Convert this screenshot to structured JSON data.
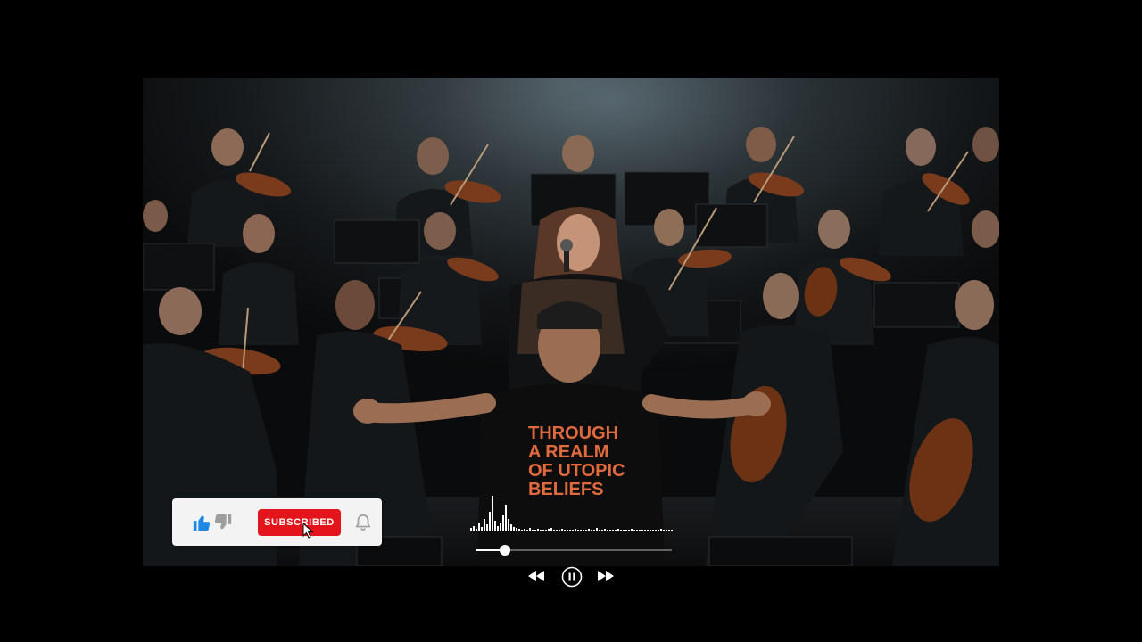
{
  "overlay": {
    "subscribe_label": "SUBSCRIBED",
    "like_icon": "thumbs-up-icon",
    "dislike_icon": "thumbs-down-icon",
    "bell_icon": "notification-bell-icon",
    "cursor_icon": "mouse-pointer-icon"
  },
  "video": {
    "shirt_text": [
      "THROUGH",
      "A REALM",
      "OF UTOPIC",
      "BELIEFS"
    ]
  },
  "player": {
    "progress_fraction": 0.15,
    "rewind_icon": "rewind-icon",
    "pause_icon": "pause-icon",
    "forward_icon": "fast-forward-icon"
  },
  "colors": {
    "subscribe_red": "#e3141c",
    "like_blue": "#1e88e5",
    "shirt_text_orange": "#e06a3c",
    "background": "#000000"
  }
}
